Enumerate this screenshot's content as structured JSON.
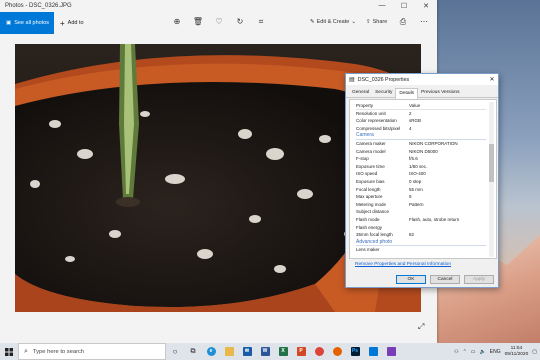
{
  "photos_app": {
    "title": "Photos - DSC_0326.JPG",
    "window_controls": [
      "—",
      "☐",
      "✕"
    ],
    "see_all_label": "See all photos",
    "add_to_label": "Add to",
    "edit_create_label": "Edit & Create",
    "share_label": "Share"
  },
  "dialog": {
    "title": "DSC_0326 Properties",
    "tabs": [
      "General",
      "Security",
      "Details",
      "Previous Versions"
    ],
    "header": {
      "k": "Property",
      "v": "Value"
    },
    "rows": [
      {
        "k": "Resolution unit",
        "v": "2"
      },
      {
        "k": "Color representation",
        "v": "sRGB"
      },
      {
        "k": "Compressed bits/pixel",
        "v": "4"
      },
      {
        "k": "Camera",
        "v": "",
        "section": true
      },
      {
        "k": "Camera maker",
        "v": "NIKON CORPORATION"
      },
      {
        "k": "Camera model",
        "v": "NIKON D5000"
      },
      {
        "k": "F-stop",
        "v": "f/5.6"
      },
      {
        "k": "Exposure time",
        "v": "1/60 sec."
      },
      {
        "k": "ISO speed",
        "v": "ISO-400"
      },
      {
        "k": "Exposure bias",
        "v": "0 step"
      },
      {
        "k": "Focal length",
        "v": "55 mm"
      },
      {
        "k": "Max aperture",
        "v": "5"
      },
      {
        "k": "Metering mode",
        "v": "Pattern"
      },
      {
        "k": "Subject distance",
        "v": ""
      },
      {
        "k": "Flash mode",
        "v": "Flash, auto, strobe return"
      },
      {
        "k": "Flash energy",
        "v": ""
      },
      {
        "k": "35mm focal length",
        "v": "82"
      },
      {
        "k": "Advanced photo",
        "v": "",
        "section": true
      },
      {
        "k": "Lens maker",
        "v": ""
      }
    ],
    "remove_link": "Remove Properties and Personal Information",
    "ok_label": "OK",
    "cancel_label": "Cancel",
    "apply_label": "Apply"
  },
  "taskbar": {
    "search_placeholder": "Type here to search",
    "language": "ENG",
    "time": "11:54",
    "date": "09/11/2020"
  }
}
